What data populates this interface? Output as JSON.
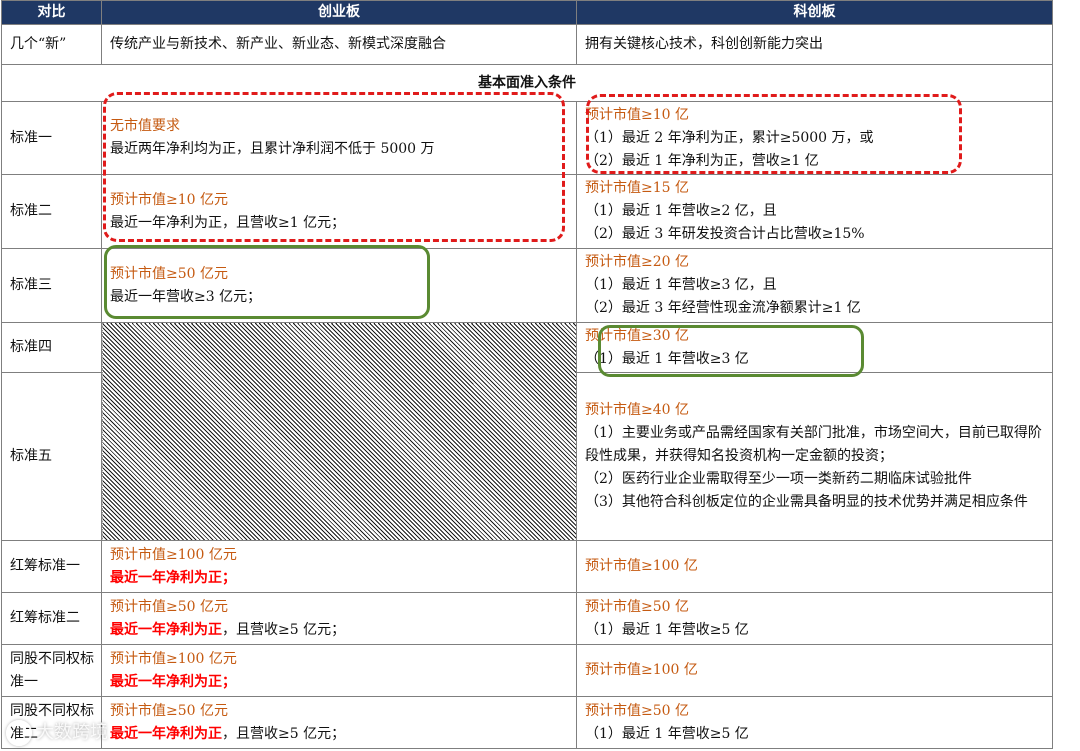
{
  "header": {
    "col1": "对比",
    "col2": "创业板",
    "col3": "科创板"
  },
  "intro": {
    "label": "几个“新”",
    "cyb": "传统产业与新技术、新产业、新业态、新模式深度融合",
    "kcb": "拥有关键核心技术，科创创新能力突出"
  },
  "section_title": "基本面准入条件",
  "rows": [
    {
      "label": "标准一",
      "cyb": [
        {
          "text": "无市值要求",
          "style": "brown"
        },
        {
          "text": "最近两年净利均为正，且累计净利润不低于 5000 万",
          "style": "plain"
        }
      ],
      "kcb": [
        {
          "text": "预计市值≥10 亿",
          "style": "brown"
        },
        {
          "text": "（1）最近 2 年净利为正，累计≥5000 万，或",
          "style": "plain"
        },
        {
          "text": "（2）最近 1 年净利为正，营收≥1 亿",
          "style": "plain"
        }
      ]
    },
    {
      "label": "标准二",
      "cyb": [
        {
          "text": "预计市值≥10 亿元",
          "style": "brown"
        },
        {
          "text": "最近一年净利为正，且营收≥1 亿元；",
          "style": "plain"
        }
      ],
      "kcb": [
        {
          "text": "预计市值≥15 亿",
          "style": "brown"
        },
        {
          "text": "（1）最近 1 年营收≥2 亿，且",
          "style": "plain"
        },
        {
          "text": "（2）最近 3 年研发投资合计占比营收≥15%",
          "style": "plain"
        }
      ]
    },
    {
      "label": "标准三",
      "cyb": [
        {
          "text": "预计市值≥50 亿元",
          "style": "brown"
        },
        {
          "text": "最近一年营收≥3 亿元；",
          "style": "plain"
        }
      ],
      "kcb": [
        {
          "text": "预计市值≥20 亿",
          "style": "brown"
        },
        {
          "text": "（1）最近 1 年营收≥3 亿，且",
          "style": "plain"
        },
        {
          "text": "（2）最近 3 年经营性现金流净额累计≥1 亿",
          "style": "plain"
        }
      ]
    },
    {
      "label": "标准四",
      "cyb": [],
      "kcb": [
        {
          "text": "预计市值≥30 亿",
          "style": "brown"
        },
        {
          "text": "（1）最近 1 年营收≥3 亿",
          "style": "plain"
        }
      ]
    },
    {
      "label": "标准五",
      "cyb": [],
      "kcb": [
        {
          "text": "预计市值≥40 亿",
          "style": "brown"
        },
        {
          "text": "（1）主要业务或产品需经国家有关部门批准，市场空间大，目前已取得阶段性成果，并获得知名投资机构一定金额的投资；",
          "style": "plain",
          "wrap": true
        },
        {
          "text": "（2）医药行业企业需取得至少一项一类新药二期临床试验批件",
          "style": "plain"
        },
        {
          "text": "（3）其他符合科创板定位的企业需具备明显的技术优势并满足相应条件",
          "style": "plain",
          "wrap": true
        }
      ]
    },
    {
      "label": "红筹标准一",
      "cyb": [
        {
          "text": "预计市值≥100 亿元",
          "style": "brown"
        },
        {
          "text": "最近一年净利为正；",
          "style": "red"
        }
      ],
      "kcb": [
        {
          "text": "预计市值≥100 亿",
          "style": "brown"
        }
      ]
    },
    {
      "label": "红筹标准二",
      "cyb": [
        {
          "text": "预计市值≥50 亿元",
          "style": "brown"
        },
        {
          "text": "最近一年净利为正",
          "style": "red",
          "suffix": "，且营收≥5 亿元；"
        }
      ],
      "kcb": [
        {
          "text": "预计市值≥50 亿",
          "style": "brown"
        },
        {
          "text": "（1）最近 1 年营收≥5 亿",
          "style": "plain"
        }
      ]
    },
    {
      "label": "同股不同权标准一",
      "cyb": [
        {
          "text": "预计市值≥100 亿元",
          "style": "brown"
        },
        {
          "text": "最近一年净利为正；",
          "style": "red"
        }
      ],
      "kcb": [
        {
          "text": "预计市值≥100 亿",
          "style": "brown"
        }
      ]
    },
    {
      "label": "同股不同权标准二",
      "cyb": [
        {
          "text": "预计市值≥50 亿元",
          "style": "brown"
        },
        {
          "text": "最近一年净利为正",
          "style": "red",
          "suffix": "，且营收≥5 亿元；"
        }
      ],
      "kcb": [
        {
          "text": "预计市值≥50 亿",
          "style": "brown"
        },
        {
          "text": "（1）最近 1 年营收≥5 亿",
          "style": "plain"
        }
      ]
    }
  ],
  "watermark": "大数跨境",
  "colors": {
    "header_bg": "#1f3864",
    "brown": "#c55a11",
    "red": "#ff0000",
    "red_annotation": "#e01b1b",
    "green_annotation": "#5a8a32"
  }
}
